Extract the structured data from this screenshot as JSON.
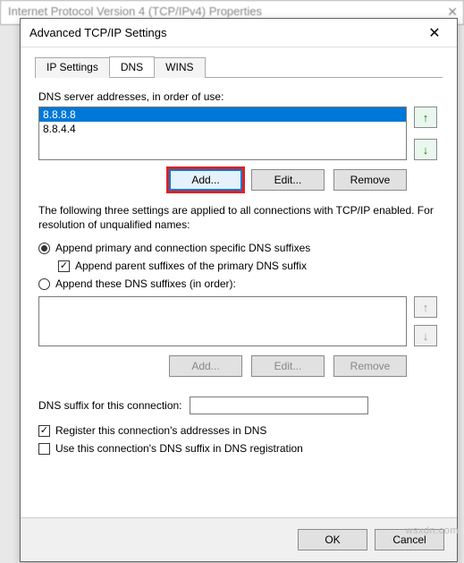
{
  "bg_dialog": {
    "title": "Internet Protocol Version 4 (TCP/IPv4) Properties",
    "close": "✕"
  },
  "dialog": {
    "title": "Advanced TCP/IP Settings",
    "close": "✕"
  },
  "tabs": {
    "ip": "IP Settings",
    "dns": "DNS",
    "wins": "WINS"
  },
  "dns": {
    "servers_label": "DNS server addresses, in order of use:",
    "servers": [
      "8.8.8.8",
      "8.8.4.4"
    ],
    "add": "Add...",
    "edit": "Edit...",
    "remove": "Remove",
    "explain": "The following three settings are applied to all connections with TCP/IP enabled. For resolution of unqualified names:",
    "radio_primary": "Append primary and connection specific DNS suffixes",
    "check_parent": "Append parent suffixes of the primary DNS suffix",
    "radio_these": "Append these DNS suffixes (in order):",
    "suffix_add": "Add...",
    "suffix_edit": "Edit...",
    "suffix_remove": "Remove",
    "suffix_label": "DNS suffix for this connection:",
    "check_register": "Register this connection's addresses in DNS",
    "check_usedns": "Use this connection's DNS suffix in DNS registration"
  },
  "footer": {
    "ok": "OK",
    "cancel": "Cancel"
  },
  "arrows": {
    "up": "↑",
    "down": "↓"
  },
  "watermark": "wsxdn.com"
}
